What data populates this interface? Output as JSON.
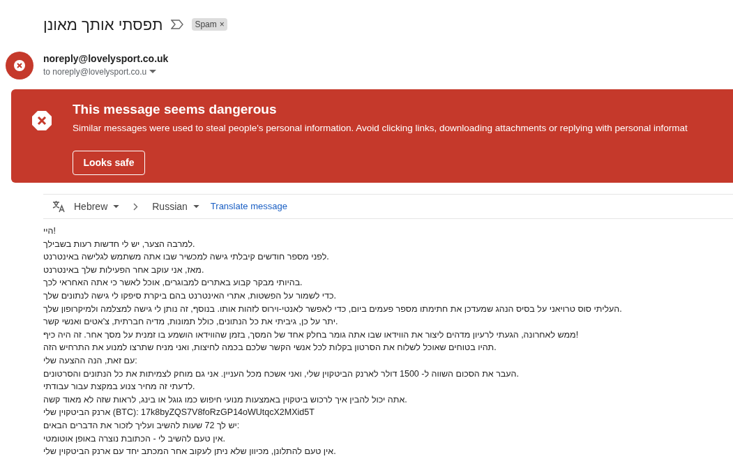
{
  "subject": "תפסתי אותך מאונן",
  "label": {
    "text": "Spam",
    "remove": "×"
  },
  "sender": {
    "email": "noreply@lovelysport.co.uk",
    "to": "to noreply@lovelysport.co.u"
  },
  "warning": {
    "title": "This message seems dangerous",
    "text": "Similar messages were used to steal people's personal information. Avoid clicking links, downloading attachments or replying with personal informat",
    "button": "Looks safe"
  },
  "translate": {
    "from": "Hebrew",
    "to": "Russian",
    "action": "Translate message"
  },
  "body": [
    "היי!",
    "למרבה הצער, יש לי חדשות רעות בשבילך.",
    "לפני מספר חודשים קיבלתי גישה למכשיר שבו אתה משתמש לגלישה באינטרנט.",
    "מאז, אני עוקב אחר הפעילות שלך באינטרנט.",
    "בהיותי מבקר קבוע באתרים למבוגרים, אוכל לאשר כי אתה האחראי לכך.",
    "כדי לשמור על הפשטות, אתרי האינטרנט בהם ביקרת סיפקו לי גישה לנתונים שלך.",
    "העליתי סוס טרויאני על בסיס הנהג שמעדכן את חתימתו מספר פעמים ביום, כדי לאפשר לאנטי-וירוס לזהות אותו. בנוסף, זה נותן לי גישה למצלמה ולמיקרופון שלך.",
    "יתר על כן, גיביתי את כל הנתונים, כולל תמונות, מדיה חברתית, צ'אטים ואנשי קשר.",
    "ממש לאחרונה, הגעתי לרעיון מדהים ליצור את הווידאו שבו אתה גומר בחלק אחד של המסך, בזמן שהווידאו הושמע בו זמנית על מסך אחר. זה היה כיף!",
    "תהיו בטוחים שאוכל לשלוח את הסרטון בקלות לכל אנשי הקשר שלכם בכמה לחיצות, ואני מניח שתרצו למנוע את התרחיש הזה.",
    "עם זאת, הנה ההצעה שלי:",
    "העבר את הסכום השווה ל- 1500 דולר לארנק הביטקוין שלי, ואני אשכח מכל העניין. אני גם מוחק לצמיתות את כל הנתונים והסרטונים.",
    "לדעתי זה מחיר צנוע במקצת עבור עבודתי.",
    "אתה יכול להבין איך לרכוש ביטקוין באמצעות מנועי חיפוש כמו גוגל או בינג, לראות שזה לא מאוד קשה.",
    "ארנק הביטקוין שלי (BTC): 17k8byZQS7V8foRzGP14oWUtqcX2MXid5T",
    "יש לך 72 שעות להשיב ועליך לזכור את הדברים הבאים:",
    "אין טעם להשיב לי - הכתובת נוצרה באופן אוטומטי.",
    "אין טעם להתלונן, מכיוון שלא ניתן לעקוב אחר המכתב יחד עם ארנק הביטקוין שלי."
  ]
}
